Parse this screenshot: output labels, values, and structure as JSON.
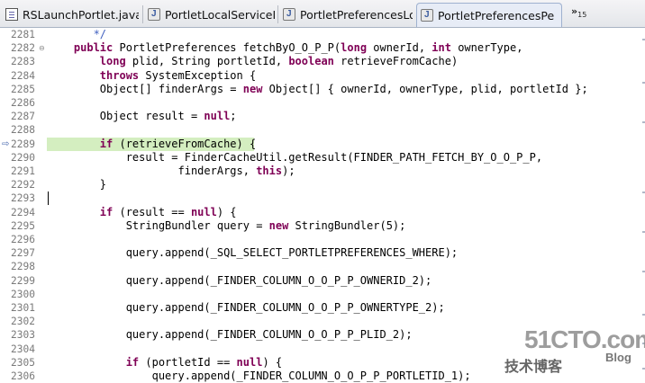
{
  "tabs": [
    {
      "label": "RSLaunchPortlet.java",
      "icon": "java-file-icon",
      "active": false
    },
    {
      "label": "PortletLocalServiceI",
      "icon": "java-class-icon",
      "active": false
    },
    {
      "label": "PortletPreferencesLo",
      "icon": "java-class-icon",
      "active": false
    },
    {
      "label": "PortletPreferencesPe",
      "icon": "java-class-icon",
      "active": true
    }
  ],
  "overflow": {
    "symbol": "»",
    "count": "15"
  },
  "current_line_marker": "⇨",
  "lines": [
    {
      "n": "2281",
      "code": [
        [
          "cm",
          "       */"
        ]
      ]
    },
    {
      "n": "2282",
      "fold": "⊖",
      "code": [
        [
          "",
          "    "
        ],
        [
          "kw",
          "public"
        ],
        [
          "",
          " PortletPreferences fetchByO_O_P_P("
        ],
        [
          "kw",
          "long"
        ],
        [
          "",
          " ownerId, "
        ],
        [
          "kw",
          "int"
        ],
        [
          "",
          " ownerType,"
        ]
      ]
    },
    {
      "n": "2283",
      "code": [
        [
          "",
          "        "
        ],
        [
          "kw",
          "long"
        ],
        [
          "",
          " plid, String portletId, "
        ],
        [
          "kw",
          "boolean"
        ],
        [
          "",
          " retrieveFromCache)"
        ]
      ]
    },
    {
      "n": "2284",
      "code": [
        [
          "",
          "        "
        ],
        [
          "kw",
          "throws"
        ],
        [
          "",
          " SystemException {"
        ]
      ]
    },
    {
      "n": "2285",
      "code": [
        [
          "",
          "        Object[] finderArgs = "
        ],
        [
          "kw",
          "new"
        ],
        [
          "",
          " Object[] { ownerId, ownerType, plid, portletId };"
        ]
      ]
    },
    {
      "n": "2286",
      "code": []
    },
    {
      "n": "2287",
      "code": [
        [
          "",
          "        Object result = "
        ],
        [
          "kw",
          "null"
        ],
        [
          "",
          ";"
        ]
      ]
    },
    {
      "n": "2288",
      "code": []
    },
    {
      "n": "2289",
      "code": [
        [
          "",
          "        "
        ],
        [
          "kw",
          "if"
        ],
        [
          "",
          " (retrieveFromCache) {"
        ]
      ],
      "highlight": true
    },
    {
      "n": "2290",
      "code": [
        [
          "",
          "            result = FinderCacheUtil.getResult(FINDER_PATH_FETCH_BY_O_O_P_P,"
        ]
      ]
    },
    {
      "n": "2291",
      "code": [
        [
          "",
          "                    finderArgs, "
        ],
        [
          "kw",
          "this"
        ],
        [
          "",
          ");"
        ]
      ]
    },
    {
      "n": "2292",
      "code": [
        [
          "",
          "        }"
        ]
      ]
    },
    {
      "n": "2293",
      "code": [],
      "caret": true
    },
    {
      "n": "2294",
      "code": [
        [
          "",
          "        "
        ],
        [
          "kw",
          "if"
        ],
        [
          "",
          " (result == "
        ],
        [
          "kw",
          "null"
        ],
        [
          "",
          ") {"
        ]
      ]
    },
    {
      "n": "2295",
      "code": [
        [
          "",
          "            StringBundler query = "
        ],
        [
          "kw",
          "new"
        ],
        [
          "",
          " StringBundler(5);"
        ]
      ]
    },
    {
      "n": "2296",
      "code": []
    },
    {
      "n": "2297",
      "code": [
        [
          "",
          "            query.append(_SQL_SELECT_PORTLETPREFERENCES_WHERE);"
        ]
      ]
    },
    {
      "n": "2298",
      "code": []
    },
    {
      "n": "2299",
      "code": [
        [
          "",
          "            query.append(_FINDER_COLUMN_O_O_P_P_OWNERID_2);"
        ]
      ]
    },
    {
      "n": "2300",
      "code": []
    },
    {
      "n": "2301",
      "code": [
        [
          "",
          "            query.append(_FINDER_COLUMN_O_O_P_P_OWNERTYPE_2);"
        ]
      ]
    },
    {
      "n": "2302",
      "code": []
    },
    {
      "n": "2303",
      "code": [
        [
          "",
          "            query.append(_FINDER_COLUMN_O_O_P_P_PLID_2);"
        ]
      ]
    },
    {
      "n": "2304",
      "code": []
    },
    {
      "n": "2305",
      "code": [
        [
          "",
          "            "
        ],
        [
          "kw",
          "if"
        ],
        [
          "",
          " (portletId == "
        ],
        [
          "kw",
          "null"
        ],
        [
          "",
          ") {"
        ]
      ]
    },
    {
      "n": "2306",
      "code": [
        [
          "",
          "                query.append(_FINDER_COLUMN_O_O_P_P_PORTLETID_1);"
        ]
      ]
    }
  ],
  "watermark": {
    "site": "51CTO.com",
    "subtitle": "技术博客",
    "blog": "Blog"
  },
  "colors": {
    "keyword": "#7f0055",
    "comment": "#3f5fbf",
    "highlight": "#d4eec0",
    "line_number": "#7a7a7a"
  }
}
